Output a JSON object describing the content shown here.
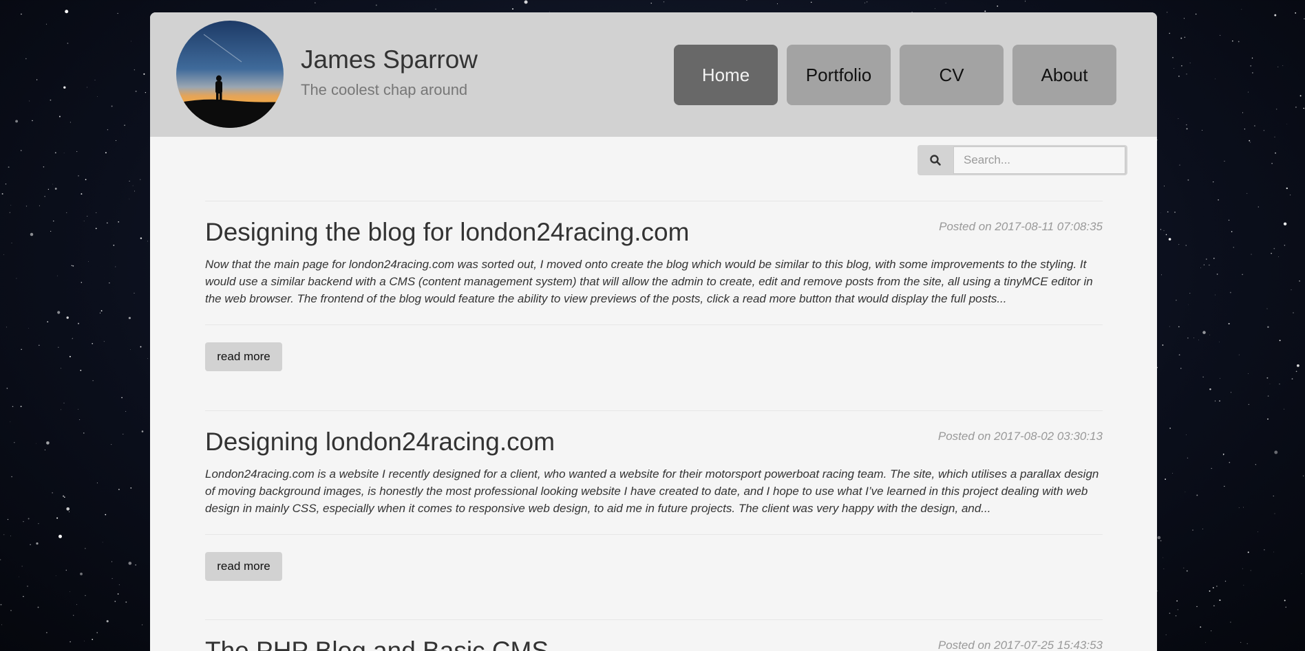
{
  "site": {
    "name": "James Sparrow",
    "tagline": "The coolest chap around"
  },
  "nav": {
    "items": [
      {
        "label": "Home",
        "active": true
      },
      {
        "label": "Portfolio",
        "active": false
      },
      {
        "label": "CV",
        "active": false
      },
      {
        "label": "About",
        "active": false
      }
    ]
  },
  "search": {
    "icon": "search-icon",
    "placeholder": "Search..."
  },
  "posts": [
    {
      "title": "Designing the blog for london24racing.com",
      "date": "Posted on 2017-08-11 07:08:35",
      "excerpt": "Now that the main page for london24racing.com was sorted out, I moved onto create the blog which would be similar to this blog, with some improvements to the styling. It would use a similar backend with a CMS (content management system) that will allow the admin to create, edit and remove posts from the site, all using a tinyMCE editor in the web browser. The frontend of the blog would feature the ability to view previews of the posts, click a read more button that would display the full posts...",
      "read_more": "read more"
    },
    {
      "title": "Designing london24racing.com",
      "date": "Posted on 2017-08-02 03:30:13",
      "excerpt": "London24racing.com is a website I recently designed for a client, who wanted a website for their motorsport powerboat racing team. The site, which utilises a parallax design of moving background images, is honestly the most professional looking website I have created to date, and I hope to use what I’ve learned in this project dealing with web design in mainly CSS, especially when it comes to responsive web design, to aid me in future projects. The client was very happy with the design, and...",
      "read_more": "read more"
    },
    {
      "title": "The PHP Blog and Basic CMS",
      "date": "Posted on 2017-07-25 15:43:53",
      "excerpt": "",
      "read_more": ""
    }
  ],
  "colors": {
    "header_bg": "#d2d2d2",
    "nav_active": "#686868",
    "nav_inactive": "#a3a3a3",
    "content_bg": "#f5f5f5"
  }
}
